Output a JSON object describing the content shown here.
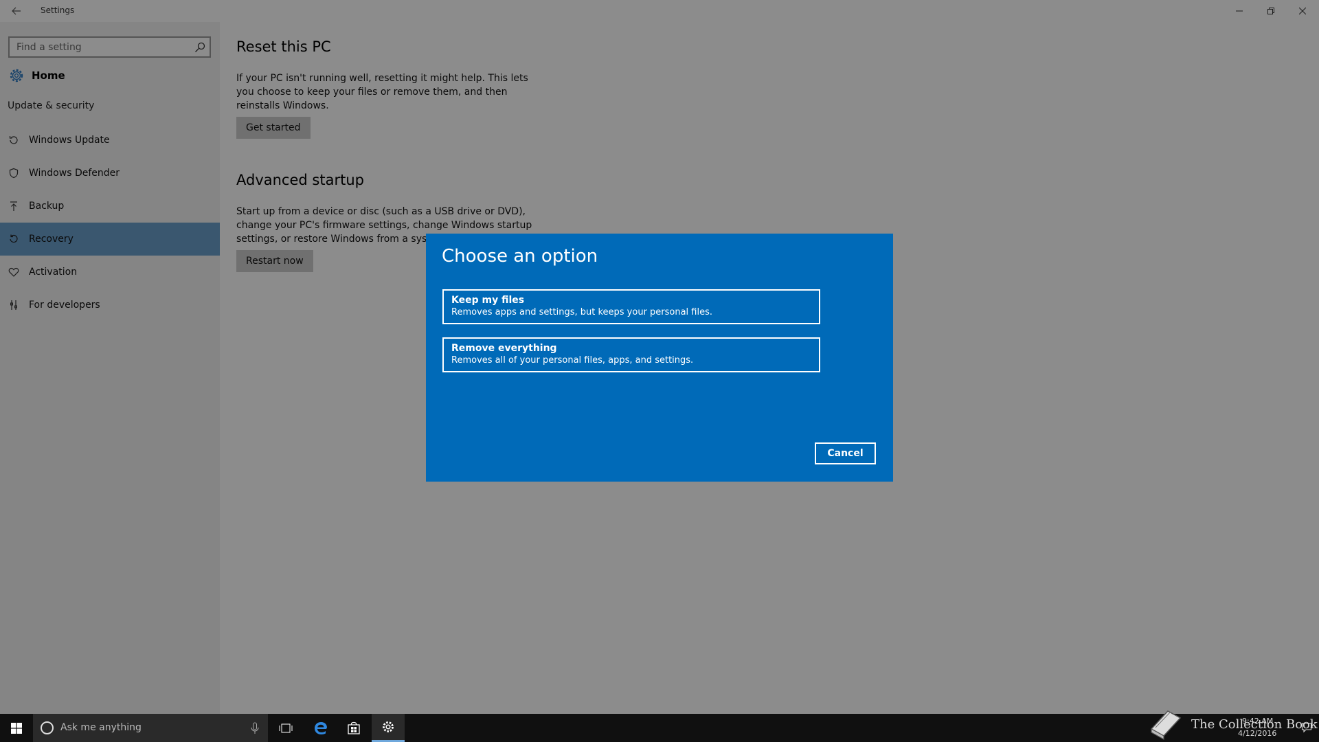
{
  "window": {
    "title": "Settings"
  },
  "sidebar": {
    "search_placeholder": "Find a setting",
    "home_label": "Home",
    "section_label": "Update & security",
    "items": [
      {
        "label": "Windows Update",
        "icon": "sync-icon"
      },
      {
        "label": "Windows Defender",
        "icon": "shield-icon"
      },
      {
        "label": "Backup",
        "icon": "upload-icon"
      },
      {
        "label": "Recovery",
        "icon": "recovery-icon",
        "active": true
      },
      {
        "label": "Activation",
        "icon": "heart-icon"
      },
      {
        "label": "For developers",
        "icon": "developer-icon"
      }
    ]
  },
  "content": {
    "reset": {
      "title": "Reset this PC",
      "body": "If your PC isn't running well, resetting it might help. This lets you choose to keep your files or remove them, and then reinstalls Windows.",
      "button": "Get started"
    },
    "advanced": {
      "title": "Advanced startup",
      "body": "Start up from a device or disc (such as a USB drive or DVD), change your PC's firmware settings, change Windows startup settings, or restore Windows from a system image. Th",
      "button": "Restart now"
    }
  },
  "dialog": {
    "title": "Choose an option",
    "options": [
      {
        "title": "Keep my files",
        "desc": "Removes apps and settings, but keeps your personal files."
      },
      {
        "title": "Remove everything",
        "desc": "Removes all of your personal files, apps, and settings."
      }
    ],
    "cancel": "Cancel",
    "bg_color": "#006ab8"
  },
  "taskbar": {
    "search_placeholder": "Ask me anything",
    "time": "9:42 AM",
    "date": "4/12/2016",
    "watermark": "The Collection Book"
  }
}
